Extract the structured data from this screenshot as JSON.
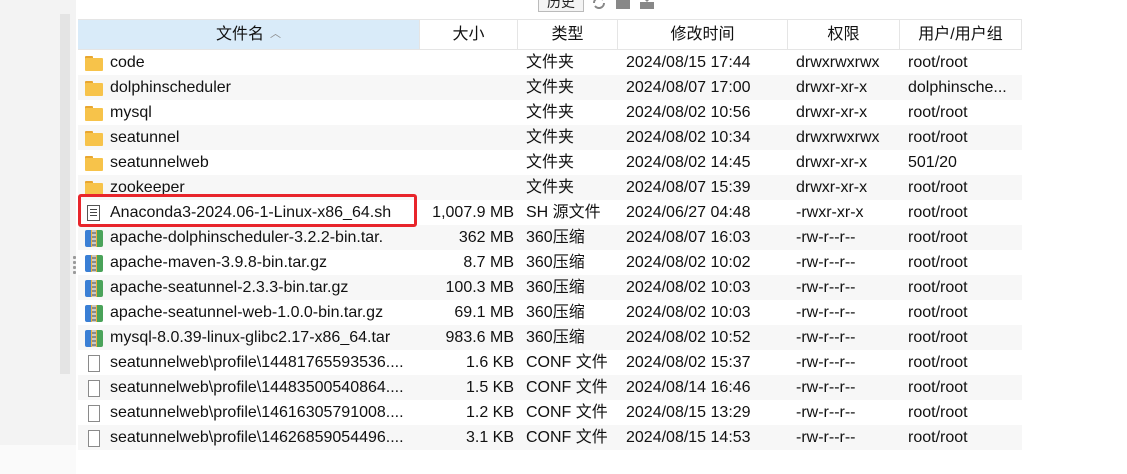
{
  "toolbar": {
    "history_label": "历史"
  },
  "columns": {
    "name": "文件名",
    "size": "大小",
    "type": "类型",
    "modified": "修改时间",
    "perms": "权限",
    "owner": "用户/用户组"
  },
  "sort": {
    "column": "name",
    "direction": "ascending"
  },
  "files": [
    {
      "icon": "folder-icon",
      "name": "code",
      "size": "",
      "type": "文件夹",
      "modified": "2024/08/15 17:44",
      "perms": "drwxrwxrwx",
      "owner": "root/root"
    },
    {
      "icon": "folder-icon",
      "name": "dolphinscheduler",
      "size": "",
      "type": "文件夹",
      "modified": "2024/08/07 17:00",
      "perms": "drwxr-xr-x",
      "owner": "dolphinsche..."
    },
    {
      "icon": "folder-icon",
      "name": "mysql",
      "size": "",
      "type": "文件夹",
      "modified": "2024/08/02 10:56",
      "perms": "drwxr-xr-x",
      "owner": "root/root"
    },
    {
      "icon": "folder-icon",
      "name": "seatunnel",
      "size": "",
      "type": "文件夹",
      "modified": "2024/08/02 10:34",
      "perms": "drwxrwxrwx",
      "owner": "root/root"
    },
    {
      "icon": "folder-icon",
      "name": "seatunnelweb",
      "size": "",
      "type": "文件夹",
      "modified": "2024/08/02 14:45",
      "perms": "drwxr-xr-x",
      "owner": "501/20"
    },
    {
      "icon": "folder-icon",
      "name": "zookeeper",
      "size": "",
      "type": "文件夹",
      "modified": "2024/08/07 15:39",
      "perms": "drwxr-xr-x",
      "owner": "root/root"
    },
    {
      "icon": "script-file-icon",
      "name": "Anaconda3-2024.06-1-Linux-x86_64.sh",
      "size": "1,007.9 MB",
      "type": "SH 源文件",
      "modified": "2024/06/27 04:48",
      "perms": "-rwxr-xr-x",
      "owner": "root/root"
    },
    {
      "icon": "archive-icon",
      "name": "apache-dolphinscheduler-3.2.2-bin.tar.",
      "size": "362 MB",
      "type": "360压缩",
      "modified": "2024/08/07 16:03",
      "perms": "-rw-r--r--",
      "owner": "root/root"
    },
    {
      "icon": "archive-icon",
      "name": "apache-maven-3.9.8-bin.tar.gz",
      "size": "8.7 MB",
      "type": "360压缩",
      "modified": "2024/08/02 10:02",
      "perms": "-rw-r--r--",
      "owner": "root/root"
    },
    {
      "icon": "archive-icon",
      "name": "apache-seatunnel-2.3.3-bin.tar.gz",
      "size": "100.3 MB",
      "type": "360压缩",
      "modified": "2024/08/02 10:03",
      "perms": "-rw-r--r--",
      "owner": "root/root"
    },
    {
      "icon": "archive-icon",
      "name": "apache-seatunnel-web-1.0.0-bin.tar.gz",
      "size": "69.1 MB",
      "type": "360压缩",
      "modified": "2024/08/02 10:03",
      "perms": "-rw-r--r--",
      "owner": "root/root"
    },
    {
      "icon": "archive-icon",
      "name": "mysql-8.0.39-linux-glibc2.17-x86_64.tar",
      "size": "983.6 MB",
      "type": "360压缩",
      "modified": "2024/08/02 10:52",
      "perms": "-rw-r--r--",
      "owner": "root/root"
    },
    {
      "icon": "file-icon",
      "name": "seatunnelweb\\profile\\14481765593536....",
      "size": "1.6 KB",
      "type": "CONF 文件",
      "modified": "2024/08/02 15:37",
      "perms": "-rw-r--r--",
      "owner": "root/root"
    },
    {
      "icon": "file-icon",
      "name": "seatunnelweb\\profile\\14483500540864....",
      "size": "1.5 KB",
      "type": "CONF 文件",
      "modified": "2024/08/14 16:46",
      "perms": "-rw-r--r--",
      "owner": "root/root"
    },
    {
      "icon": "file-icon",
      "name": "seatunnelweb\\profile\\14616305791008....",
      "size": "1.2 KB",
      "type": "CONF 文件",
      "modified": "2024/08/15 13:29",
      "perms": "-rw-r--r--",
      "owner": "root/root"
    },
    {
      "icon": "file-icon",
      "name": "seatunnelweb\\profile\\14626859054496....",
      "size": "3.1 KB",
      "type": "CONF 文件",
      "modified": "2024/08/15 14:53",
      "perms": "-rw-r--r--",
      "owner": "root/root"
    }
  ],
  "highlighted_file": "Anaconda3-2024.06-1-Linux-x86_64.sh",
  "highlight_color": "#e8252b"
}
